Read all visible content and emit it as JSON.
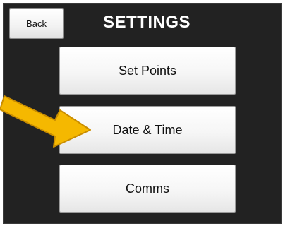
{
  "header": {
    "back_label": "Back",
    "title": "SETTINGS"
  },
  "menu": {
    "items": [
      {
        "label": "Set Points"
      },
      {
        "label": "Date & Time"
      },
      {
        "label": "Comms"
      }
    ]
  },
  "annotation": {
    "arrow_icon": "pointer-arrow-icon",
    "arrow_color": "#F5B800",
    "points_to": "Date & Time"
  },
  "colors": {
    "screen_bg": "#222222",
    "title_text": "#FFFFFF",
    "button_bg": "#F4F4F4"
  }
}
